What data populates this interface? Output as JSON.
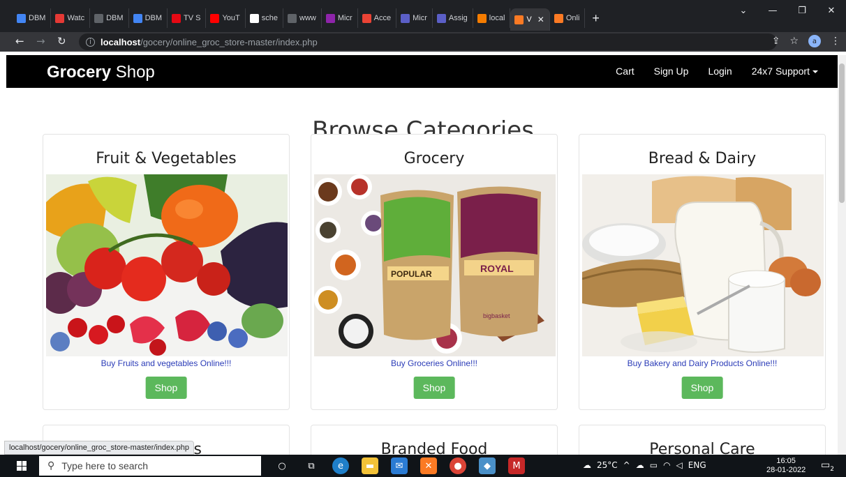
{
  "browser": {
    "tabs": [
      {
        "label": "DBM",
        "icon": "docs-icon",
        "color": "#4285f4"
      },
      {
        "label": "Watc",
        "icon": "watch-icon",
        "color": "#e53935"
      },
      {
        "label": "DBM",
        "icon": "globe-icon",
        "color": "#5f6368"
      },
      {
        "label": "DBM",
        "icon": "docs-icon",
        "color": "#4285f4"
      },
      {
        "label": "TV S",
        "icon": "netflix-icon",
        "color": "#e50914"
      },
      {
        "label": "YouT",
        "icon": "youtube-icon",
        "color": "#ff0000"
      },
      {
        "label": "sche",
        "icon": "google-icon",
        "color": "#ffffff"
      },
      {
        "label": "www",
        "icon": "globe-icon",
        "color": "#5f6368"
      },
      {
        "label": "Micr",
        "icon": "bug-icon",
        "color": "#8e24aa"
      },
      {
        "label": "Acce",
        "icon": "gmail-icon",
        "color": "#ea4335"
      },
      {
        "label": "Micr",
        "icon": "teams-icon",
        "color": "#5b5fc7"
      },
      {
        "label": "Assig",
        "icon": "teams-icon",
        "color": "#5b5fc7"
      },
      {
        "label": "local",
        "icon": "xampp-icon",
        "color": "#f57c00"
      },
      {
        "label": "V",
        "icon": "xampp-icon",
        "color": "#fb7a24",
        "active": true
      },
      {
        "label": "Onli",
        "icon": "xampp-icon",
        "color": "#fb7a24"
      }
    ],
    "new_tab": "+",
    "url_host": "localhost",
    "url_path": "/gocery/online_groc_store-master/index.php",
    "profile_initial": "a",
    "status_url": "localhost/gocery/online_groc_store-master/index.php"
  },
  "site": {
    "brand_bold": "Grocery",
    "brand_rest": " Shop",
    "nav": {
      "cart": "Cart",
      "signup": "Sign Up",
      "login": "Login",
      "support": "24x7 Support"
    },
    "heading": "Browse Categories",
    "categories": [
      {
        "title": "Fruit & Vegetables",
        "caption": "Buy Fruits and vegetables Online!!!",
        "button": "Shop"
      },
      {
        "title": "Grocery",
        "caption": "Buy Groceries Online!!!",
        "button": "Shop"
      },
      {
        "title": "Bread & Dairy",
        "caption": "Buy Bakery and Dairy Products Online!!!",
        "button": "Shop"
      }
    ],
    "more_categories": [
      {
        "title": "s"
      },
      {
        "title": "Branded Food"
      },
      {
        "title": "Personal Care"
      }
    ],
    "package_labels": {
      "left": "POPULAR",
      "right": "ROYAL",
      "brand": "bigbasket"
    }
  },
  "taskbar": {
    "search_placeholder": "Type here to search",
    "weather": "25°C",
    "lang": "ENG",
    "time": "16:05",
    "date": "28-01-2022",
    "notification_count": "2"
  }
}
